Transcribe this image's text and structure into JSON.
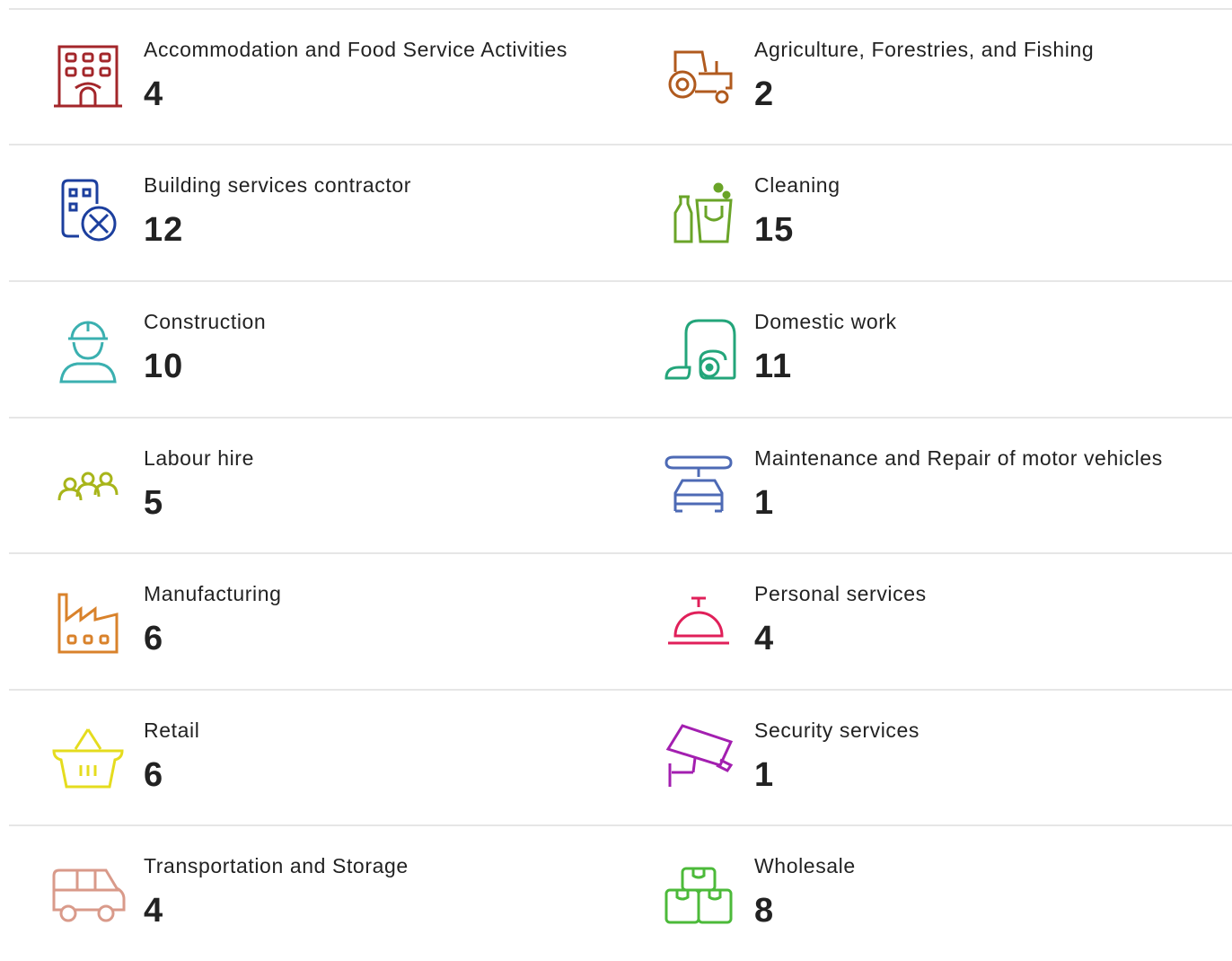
{
  "items": [
    {
      "label": "Accommodation and Food Service Activities",
      "count": "4",
      "icon": "hotel-icon",
      "color": "#a3262a"
    },
    {
      "label": "Agriculture, Forestries, and Fishing",
      "count": "2",
      "icon": "tractor-icon",
      "color": "#b05a1e"
    },
    {
      "label": "Building services contractor",
      "count": "12",
      "icon": "building-tools-icon",
      "color": "#1c3f9e"
    },
    {
      "label": "Cleaning",
      "count": "15",
      "icon": "cleaning-supplies-icon",
      "color": "#6aa428"
    },
    {
      "label": "Construction",
      "count": "10",
      "icon": "construction-worker-icon",
      "color": "#3bb0b0"
    },
    {
      "label": "Domestic work",
      "count": "11",
      "icon": "vacuum-cleaner-icon",
      "color": "#23a57a"
    },
    {
      "label": "Labour hire",
      "count": "5",
      "icon": "people-group-icon",
      "color": "#a8b51a"
    },
    {
      "label": "Maintenance and Repair of motor vehicles",
      "count": "1",
      "icon": "car-wrench-icon",
      "color": "#4d6ab5"
    },
    {
      "label": "Manufacturing",
      "count": "6",
      "icon": "factory-icon",
      "color": "#d9822b"
    },
    {
      "label": "Personal services",
      "count": "4",
      "icon": "service-bell-icon",
      "color": "#e0205a"
    },
    {
      "label": "Retail",
      "count": "6",
      "icon": "shopping-basket-icon",
      "color": "#e5dc1e"
    },
    {
      "label": "Security services",
      "count": "1",
      "icon": "security-camera-icon",
      "color": "#a31fb0"
    },
    {
      "label": "Transportation and Storage",
      "count": "4",
      "icon": "van-icon",
      "color": "#d99a8a"
    },
    {
      "label": "Wholesale",
      "count": "8",
      "icon": "boxes-icon",
      "color": "#4cba3a"
    }
  ]
}
